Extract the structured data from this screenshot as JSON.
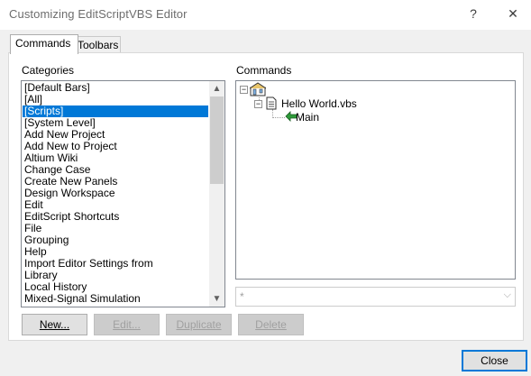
{
  "window": {
    "title": "Customizing EditScriptVBS Editor",
    "help_glyph": "?",
    "close_glyph": "✕"
  },
  "tabs": [
    {
      "label": "Commands",
      "active": true
    },
    {
      "label": "Toolbars",
      "active": false
    }
  ],
  "categories": {
    "label": "Categories",
    "selected": "[Scripts]",
    "items": [
      "[Default Bars]",
      "[All]",
      "[Scripts]",
      "[System Level]",
      "Add New Project",
      "Add New to Project",
      "Altium Wiki",
      "Change Case",
      "Create New Panels",
      "Design Workspace",
      "Edit",
      "EditScript Shortcuts",
      "File",
      "Grouping",
      "Help",
      "Import Editor Settings from",
      "Library",
      "Local History",
      "Mixed-Signal Simulation"
    ]
  },
  "commands": {
    "label": "Commands",
    "tree": {
      "root_expander": "−",
      "file_expander": "−",
      "file": "Hello World.vbs",
      "procedure": "Main"
    },
    "combo_value": "*"
  },
  "buttons": {
    "new": "New...",
    "edit": "Edit...",
    "duplicate": "Duplicate",
    "delete": "Delete",
    "close": "Close"
  },
  "colors": {
    "selection": "#0078d7",
    "default_button_border": "#0078d7",
    "disabled_text": "#a0a0a0"
  }
}
